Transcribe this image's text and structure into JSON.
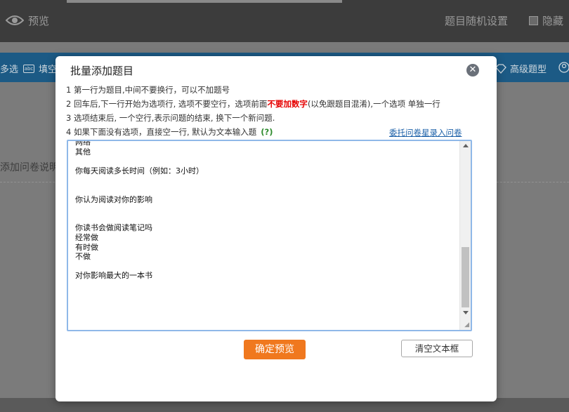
{
  "topbar": {
    "preview_label": "预览",
    "random_settings": "题目随机设置",
    "hide_label": "隐藏"
  },
  "toolbar": {
    "items": [
      "多选",
      "填空",
      "高级题型"
    ]
  },
  "background": {
    "add_description": "添加问卷说明"
  },
  "modal": {
    "title": "批量添加题目",
    "instructions": {
      "line1": "1 第一行为题目,中间不要换行，可以不加题号",
      "line2_pre": "2 回车后,下一行开始为选项行, 选项不要空行，选项前面",
      "line2_red": "不要加数字",
      "line2_post": "(以免跟题目混淆),一个选项 单独一行",
      "line3": "3 选项结束后, 一个空行,表示问题的结束, 换下一个新问题.",
      "line4": "4 如果下面没有选项，直接空一行, 默认为文本输入题",
      "help": "(?)"
    },
    "delegate_link": "委托问卷星录入问卷",
    "textarea_lines": [
      "网络",
      "其他",
      "",
      "你每天阅读多长时间（例如：3小时）",
      "",
      "",
      "你认为阅读对你的影响",
      "",
      "",
      "你读书会做阅读笔记吗",
      "经常做",
      "有时做",
      "不做",
      "",
      "对你影响最大的一本书"
    ],
    "confirm_button": "确定预览",
    "clear_button": "清空文本框"
  }
}
